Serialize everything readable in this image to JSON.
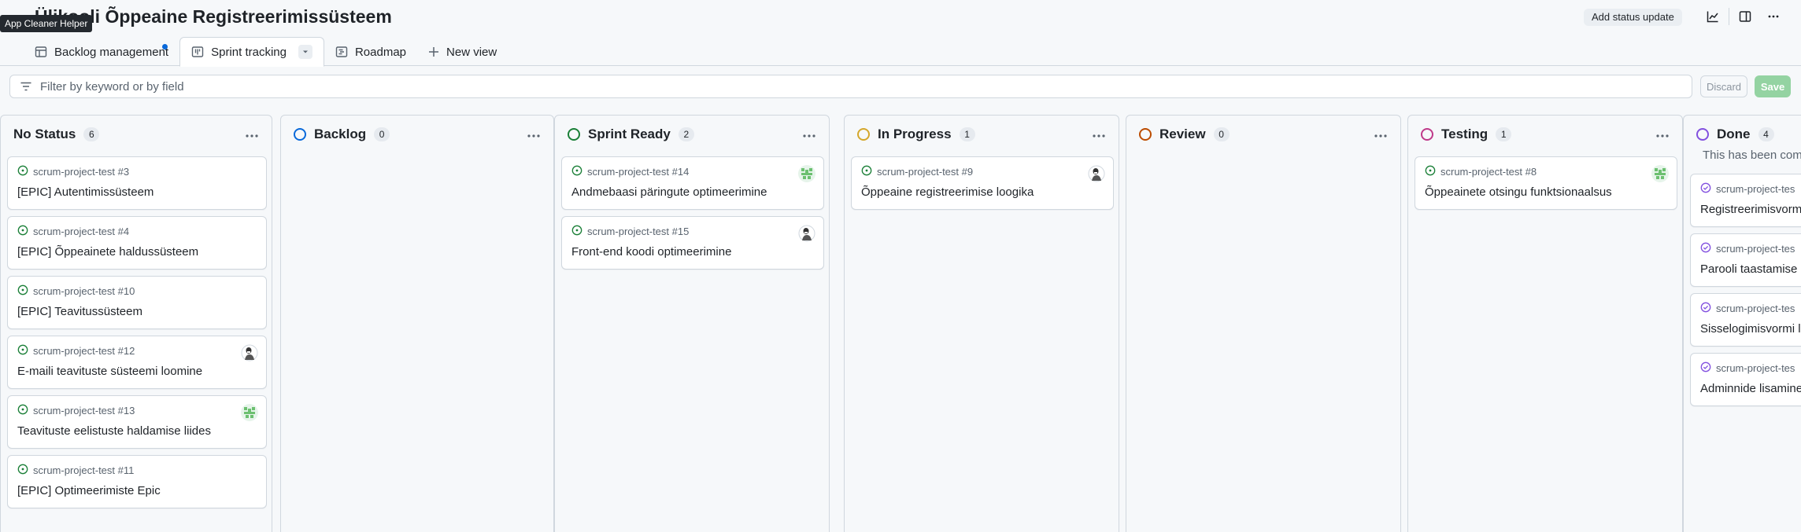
{
  "header": {
    "title": "Ülikooli Õppeaine Registreerimissüsteem",
    "tooltip": "App Cleaner Helper",
    "status_update_label": "Add status update",
    "icons": [
      "insights-icon",
      "side-panel-icon",
      "kebab-menu-icon"
    ]
  },
  "tabs": [
    {
      "label": "Backlog management",
      "icon": "table-icon",
      "active": false,
      "unsaved_dot": true
    },
    {
      "label": "Sprint tracking",
      "icon": "board-icon",
      "active": true
    },
    {
      "label": "Roadmap",
      "icon": "roadmap-icon",
      "active": false
    },
    {
      "label": "New view",
      "icon": "plus-icon",
      "active": false
    }
  ],
  "filter": {
    "placeholder": "Filter by keyword or by field",
    "discard_label": "Discard",
    "save_label": "Save"
  },
  "colors": {
    "open_issue": "#1a7f37",
    "closed_issue": "#8250df",
    "no_status": "#1f2328",
    "backlog": "#0969da",
    "sprint_ready": "#1a7f37",
    "in_progress": "#d4a72c",
    "review": "#bc4c00",
    "testing": "#bf3989",
    "done": "#8250df"
  },
  "columns": [
    {
      "name": "No Status",
      "count": "6",
      "circle": "none",
      "cards": [
        {
          "ref": "scrum-project-test #3",
          "title": "[EPIC] Autentimissüsteem",
          "avatar": ""
        },
        {
          "ref": "scrum-project-test #4",
          "title": "[EPIC] Õppeainete haldussüsteem",
          "avatar": ""
        },
        {
          "ref": "scrum-project-test #10",
          "title": "[EPIC] Teavitussüsteem",
          "avatar": ""
        },
        {
          "ref": "scrum-project-test #12",
          "title": "E-maili teavituste süsteemi loomine",
          "avatar": "bw"
        },
        {
          "ref": "scrum-project-test #13",
          "title": "Teavituste eelistuste haldamise liides",
          "avatar": "green"
        },
        {
          "ref": "scrum-project-test #11",
          "title": "[EPIC] Optimeerimiste Epic",
          "avatar": ""
        }
      ]
    },
    {
      "name": "Backlog",
      "count": "0",
      "circle": "#0969da",
      "cards": []
    },
    {
      "name": "Sprint Ready",
      "count": "2",
      "circle": "#1a7f37",
      "cards": [
        {
          "ref": "scrum-project-test #14",
          "title": "Andmebaasi päringute optimeerimine",
          "avatar": "green"
        },
        {
          "ref": "scrum-project-test #15",
          "title": "Front-end koodi optimeerimine",
          "avatar": "bw"
        }
      ]
    },
    {
      "name": "In Progress",
      "count": "1",
      "circle": "#d4a72c",
      "cards": [
        {
          "ref": "scrum-project-test #9",
          "title": "Õppeaine registreerimise loogika",
          "avatar": "bw"
        }
      ]
    },
    {
      "name": "Review",
      "count": "0",
      "circle": "#bc4c00",
      "cards": []
    },
    {
      "name": "Testing",
      "count": "1",
      "circle": "#bf3989",
      "cards": [
        {
          "ref": "scrum-project-test #8",
          "title": "Õppeainete otsingu funktsionaalsus",
          "avatar": "green"
        }
      ]
    },
    {
      "name": "Done",
      "count": "4",
      "circle": "#8250df",
      "description": "This has been comp",
      "cards": [
        {
          "ref": "scrum-project-tes",
          "title": "Registreerimisvorm",
          "closed": true
        },
        {
          "ref": "scrum-project-tes",
          "title": "Parooli taastamise",
          "closed": true
        },
        {
          "ref": "scrum-project-tes",
          "title": "Sisselogimisvormi l",
          "closed": true
        },
        {
          "ref": "scrum-project-tes",
          "title": "Adminnide lisamine",
          "closed": true
        }
      ]
    }
  ]
}
